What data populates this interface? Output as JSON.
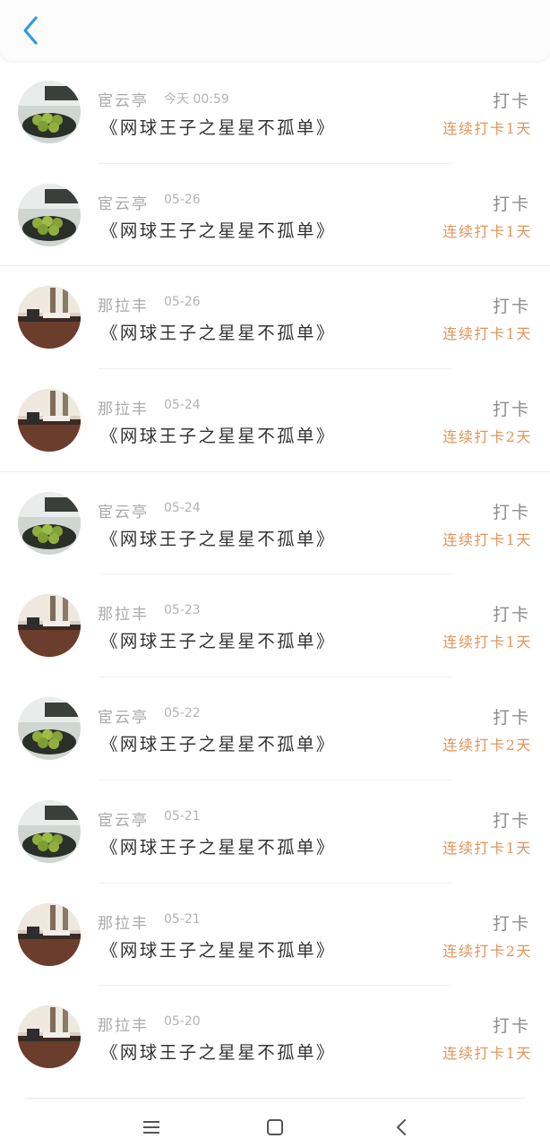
{
  "header": {
    "back_icon": "chevron-left-icon",
    "accent_color": "#2f9be6"
  },
  "records": [
    {
      "user": "宦云亭",
      "time": "今天 00:59",
      "book": "《网球王子之星星不孤单》",
      "action": "打卡",
      "streak": "连续打卡1天",
      "avatar": "plates"
    },
    {
      "user": "宦云亭",
      "time": "05-26",
      "book": "《网球王子之星星不孤单》",
      "action": "打卡",
      "streak": "连续打卡1天",
      "avatar": "plates"
    },
    {
      "user": "那拉丰",
      "time": "05-26",
      "book": "《网球王子之星星不孤单》",
      "action": "打卡",
      "streak": "连续打卡1天",
      "avatar": "desk"
    },
    {
      "user": "那拉丰",
      "time": "05-24",
      "book": "《网球王子之星星不孤单》",
      "action": "打卡",
      "streak": "连续打卡2天",
      "avatar": "desk"
    },
    {
      "user": "宦云亭",
      "time": "05-24",
      "book": "《网球王子之星星不孤单》",
      "action": "打卡",
      "streak": "连续打卡1天",
      "avatar": "plates"
    },
    {
      "user": "那拉丰",
      "time": "05-23",
      "book": "《网球王子之星星不孤单》",
      "action": "打卡",
      "streak": "连续打卡1天",
      "avatar": "desk"
    },
    {
      "user": "宦云亭",
      "time": "05-22",
      "book": "《网球王子之星星不孤单》",
      "action": "打卡",
      "streak": "连续打卡2天",
      "avatar": "plates"
    },
    {
      "user": "宦云亭",
      "time": "05-21",
      "book": "《网球王子之星星不孤单》",
      "action": "打卡",
      "streak": "连续打卡1天",
      "avatar": "plates"
    },
    {
      "user": "那拉丰",
      "time": "05-21",
      "book": "《网球王子之星星不孤单》",
      "action": "打卡",
      "streak": "连续打卡2天",
      "avatar": "desk"
    },
    {
      "user": "那拉丰",
      "time": "05-20",
      "book": "《网球王子之星星不孤单》",
      "action": "打卡",
      "streak": "连续打卡1天",
      "avatar": "desk"
    }
  ],
  "colors": {
    "streak": "#e0955b",
    "name": "#a9a9a9",
    "title": "#333333"
  },
  "navbar": {
    "menu_icon": "menu-icon",
    "home_icon": "home-square-icon",
    "back_icon": "back-triangle-icon"
  }
}
